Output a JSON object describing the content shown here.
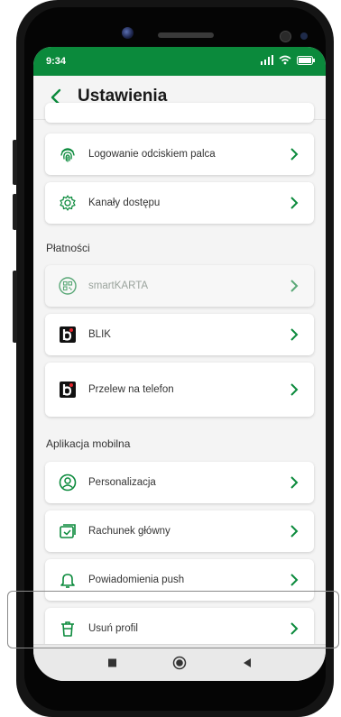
{
  "status": {
    "time": "9:34"
  },
  "header": {
    "title": "Ustawienia"
  },
  "security_items": [
    {
      "label": "Logowanie odciskiem palca",
      "icon": "fingerprint-icon"
    },
    {
      "label": "Kanały dostępu",
      "icon": "settings-gear-icon"
    }
  ],
  "payments": {
    "title": "Płatności",
    "items": [
      {
        "label": "smartKARTA",
        "icon": "qr-code-icon",
        "disabled": true
      },
      {
        "label": "BLIK",
        "icon": "blik-logo-icon"
      },
      {
        "label": "Przelew na telefon",
        "icon": "blik-logo-icon"
      }
    ]
  },
  "mobile_app": {
    "title": "Aplikacja mobilna",
    "items": [
      {
        "label": "Personalizacja",
        "icon": "user-circle-icon"
      },
      {
        "label": "Rachunek główny",
        "icon": "main-account-icon"
      },
      {
        "label": "Powiadomienia push",
        "icon": "bell-icon"
      },
      {
        "label": "Usuń profil",
        "icon": "trash-icon"
      }
    ]
  },
  "colors": {
    "accent": "#0b8a3c",
    "statusbar": "#0b8a3c",
    "background": "#f4f4f4"
  }
}
